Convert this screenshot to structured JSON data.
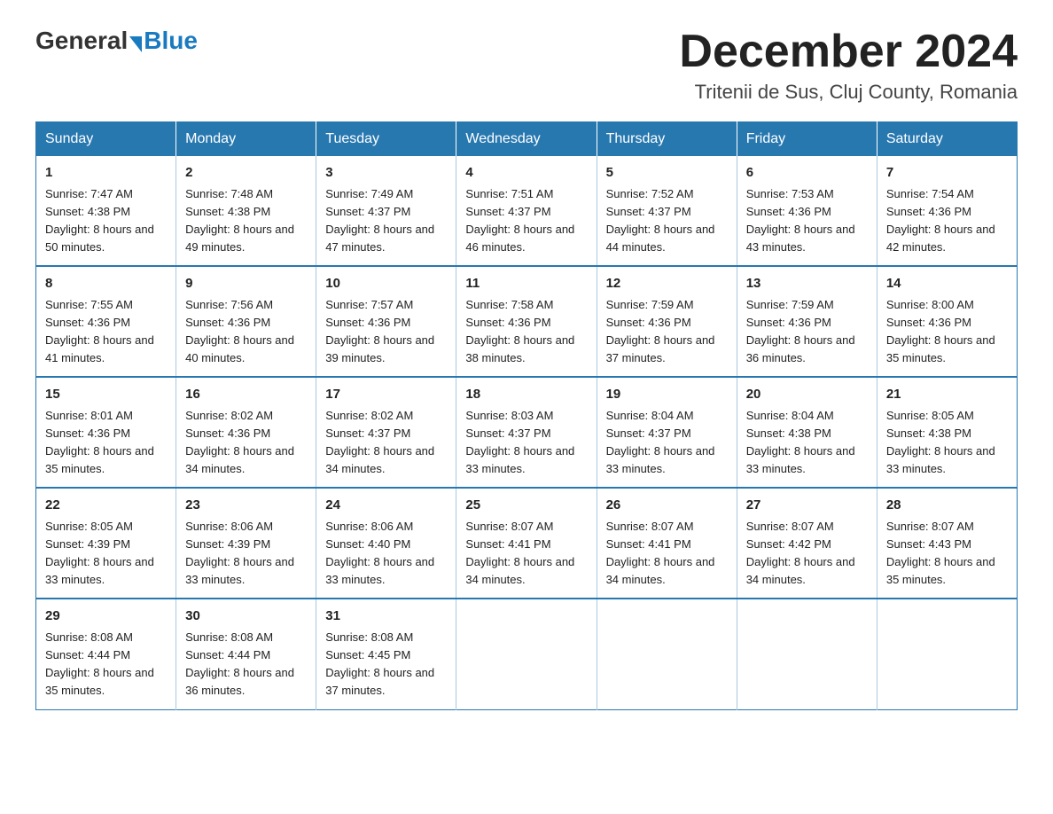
{
  "header": {
    "logo_general": "General",
    "logo_blue": "Blue",
    "month_title": "December 2024",
    "location": "Tritenii de Sus, Cluj County, Romania"
  },
  "days_of_week": [
    "Sunday",
    "Monday",
    "Tuesday",
    "Wednesday",
    "Thursday",
    "Friday",
    "Saturday"
  ],
  "weeks": [
    [
      {
        "day": "1",
        "sunrise": "7:47 AM",
        "sunset": "4:38 PM",
        "daylight": "8 hours and 50 minutes."
      },
      {
        "day": "2",
        "sunrise": "7:48 AM",
        "sunset": "4:38 PM",
        "daylight": "8 hours and 49 minutes."
      },
      {
        "day": "3",
        "sunrise": "7:49 AM",
        "sunset": "4:37 PM",
        "daylight": "8 hours and 47 minutes."
      },
      {
        "day": "4",
        "sunrise": "7:51 AM",
        "sunset": "4:37 PM",
        "daylight": "8 hours and 46 minutes."
      },
      {
        "day": "5",
        "sunrise": "7:52 AM",
        "sunset": "4:37 PM",
        "daylight": "8 hours and 44 minutes."
      },
      {
        "day": "6",
        "sunrise": "7:53 AM",
        "sunset": "4:36 PM",
        "daylight": "8 hours and 43 minutes."
      },
      {
        "day": "7",
        "sunrise": "7:54 AM",
        "sunset": "4:36 PM",
        "daylight": "8 hours and 42 minutes."
      }
    ],
    [
      {
        "day": "8",
        "sunrise": "7:55 AM",
        "sunset": "4:36 PM",
        "daylight": "8 hours and 41 minutes."
      },
      {
        "day": "9",
        "sunrise": "7:56 AM",
        "sunset": "4:36 PM",
        "daylight": "8 hours and 40 minutes."
      },
      {
        "day": "10",
        "sunrise": "7:57 AM",
        "sunset": "4:36 PM",
        "daylight": "8 hours and 39 minutes."
      },
      {
        "day": "11",
        "sunrise": "7:58 AM",
        "sunset": "4:36 PM",
        "daylight": "8 hours and 38 minutes."
      },
      {
        "day": "12",
        "sunrise": "7:59 AM",
        "sunset": "4:36 PM",
        "daylight": "8 hours and 37 minutes."
      },
      {
        "day": "13",
        "sunrise": "7:59 AM",
        "sunset": "4:36 PM",
        "daylight": "8 hours and 36 minutes."
      },
      {
        "day": "14",
        "sunrise": "8:00 AM",
        "sunset": "4:36 PM",
        "daylight": "8 hours and 35 minutes."
      }
    ],
    [
      {
        "day": "15",
        "sunrise": "8:01 AM",
        "sunset": "4:36 PM",
        "daylight": "8 hours and 35 minutes."
      },
      {
        "day": "16",
        "sunrise": "8:02 AM",
        "sunset": "4:36 PM",
        "daylight": "8 hours and 34 minutes."
      },
      {
        "day": "17",
        "sunrise": "8:02 AM",
        "sunset": "4:37 PM",
        "daylight": "8 hours and 34 minutes."
      },
      {
        "day": "18",
        "sunrise": "8:03 AM",
        "sunset": "4:37 PM",
        "daylight": "8 hours and 33 minutes."
      },
      {
        "day": "19",
        "sunrise": "8:04 AM",
        "sunset": "4:37 PM",
        "daylight": "8 hours and 33 minutes."
      },
      {
        "day": "20",
        "sunrise": "8:04 AM",
        "sunset": "4:38 PM",
        "daylight": "8 hours and 33 minutes."
      },
      {
        "day": "21",
        "sunrise": "8:05 AM",
        "sunset": "4:38 PM",
        "daylight": "8 hours and 33 minutes."
      }
    ],
    [
      {
        "day": "22",
        "sunrise": "8:05 AM",
        "sunset": "4:39 PM",
        "daylight": "8 hours and 33 minutes."
      },
      {
        "day": "23",
        "sunrise": "8:06 AM",
        "sunset": "4:39 PM",
        "daylight": "8 hours and 33 minutes."
      },
      {
        "day": "24",
        "sunrise": "8:06 AM",
        "sunset": "4:40 PM",
        "daylight": "8 hours and 33 minutes."
      },
      {
        "day": "25",
        "sunrise": "8:07 AM",
        "sunset": "4:41 PM",
        "daylight": "8 hours and 34 minutes."
      },
      {
        "day": "26",
        "sunrise": "8:07 AM",
        "sunset": "4:41 PM",
        "daylight": "8 hours and 34 minutes."
      },
      {
        "day": "27",
        "sunrise": "8:07 AM",
        "sunset": "4:42 PM",
        "daylight": "8 hours and 34 minutes."
      },
      {
        "day": "28",
        "sunrise": "8:07 AM",
        "sunset": "4:43 PM",
        "daylight": "8 hours and 35 minutes."
      }
    ],
    [
      {
        "day": "29",
        "sunrise": "8:08 AM",
        "sunset": "4:44 PM",
        "daylight": "8 hours and 35 minutes."
      },
      {
        "day": "30",
        "sunrise": "8:08 AM",
        "sunset": "4:44 PM",
        "daylight": "8 hours and 36 minutes."
      },
      {
        "day": "31",
        "sunrise": "8:08 AM",
        "sunset": "4:45 PM",
        "daylight": "8 hours and 37 minutes."
      },
      null,
      null,
      null,
      null
    ]
  ]
}
